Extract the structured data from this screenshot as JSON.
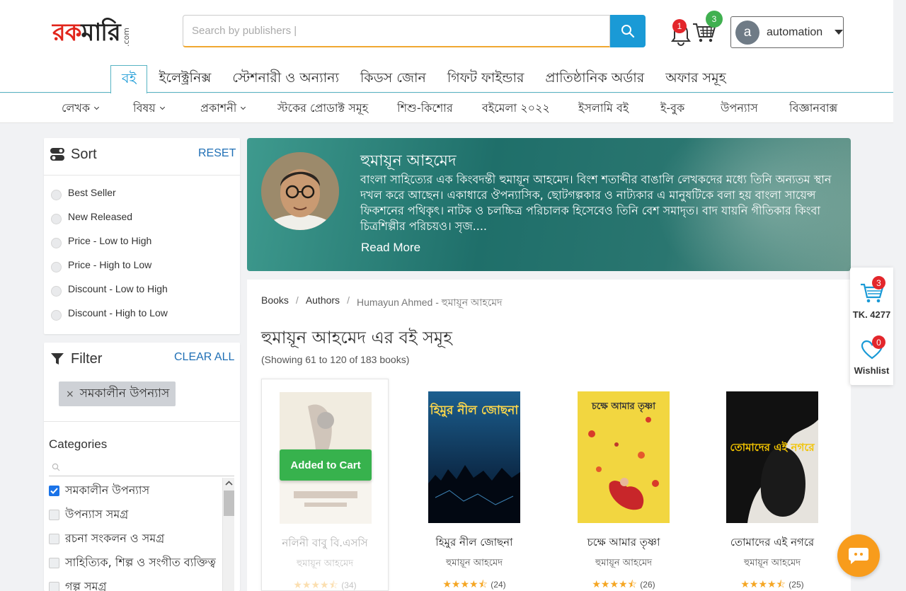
{
  "header": {
    "logo_text_red": "রক",
    "logo_text_dark": "মারি",
    "logo_com": ".com",
    "search_placeholder": "Search by publishers |",
    "notification_count": "1",
    "cart_count": "3",
    "account_initial": "a",
    "account_name": "automation"
  },
  "main_tabs": [
    "বই",
    "ইলেক্ট্রনিক্স",
    "স্টেশনারী ও অন্যান্য",
    "কিডস জোন",
    "গিফট ফাইন্ডার",
    "প্রাতিষ্ঠানিক অর্ডার",
    "অফার সমূহ"
  ],
  "sub_nav": [
    "লেখক",
    "বিষয়",
    "প্রকাশনী",
    "স্টকের প্রোডাক্ট সমূহ",
    "শিশু-কিশোর",
    "বইমেলা ২০২২",
    "ইসলামি বই",
    "ই-বুক",
    "উপন্যাস",
    "বিজ্ঞানবাক্স"
  ],
  "sort": {
    "title": "Sort",
    "reset": "RESET",
    "options": [
      "Best Seller",
      "New Released",
      "Price - Low to High",
      "Price - High to Low",
      "Discount - Low to High",
      "Discount - High to Low"
    ]
  },
  "filter": {
    "title": "Filter",
    "clear_all": "CLEAR ALL",
    "active_chip": "সমকালীন উপন্যাস",
    "chip_remove": "×",
    "categories_title": "Categories",
    "categories": [
      {
        "label": "সমকালীন উপন্যাস",
        "checked": true
      },
      {
        "label": "উপন্যাস সমগ্র",
        "checked": false
      },
      {
        "label": "রচনা সংকলন ও সমগ্র",
        "checked": false
      },
      {
        "label": "সাহিত্যিক, শিল্প ও সংগীত ব্যক্তিত্ব",
        "checked": false
      },
      {
        "label": "গল্প সমগ্র",
        "checked": false
      }
    ]
  },
  "author": {
    "name": "হুমায়ূন আহমেদ",
    "bio": "বাংলা সাহিত্যের এক কিংবদন্তী হুমায়ূন আহমেদ। বিংশ শতাব্দীর বাঙালি লেখকদের মধ্যে তিনি অন্যতম স্থান দখল করে আছেন। একাধারে ঔপন্যাসিক, ছোটগল্পকার ও নাট্যকার এ মানুষটিকে বলা হয় বাংলা সায়েন্স ফিকশনের পথিকৃৎ। নাটক ও চলচ্চিত্র পরিচালক হিসেবেও তিনি বেশ সমাদৃত। বাদ যায়নি গীতিকার কিংবা চিত্রশিল্পীর পরিচয়ও। সৃজ....",
    "read_more": "Read More"
  },
  "breadcrumb": [
    "Books",
    "Authors",
    "Humayun Ahmed - হুমায়ূন আহমেদ"
  ],
  "listing": {
    "title": "হুমায়ূন আহমেদ এর বই সমূহ",
    "count": "(Showing 61 to 120 of 183 books)",
    "added_label": "Added to Cart",
    "books": [
      {
        "title": "নলিনী বাবু বি.এসসি",
        "author": "হুমায়ূন আহমেদ",
        "stars": "★★★★⯪",
        "reviews": "(34)",
        "in_cart": true
      },
      {
        "title": "হিমুর নীল জোছনা",
        "author": "হুমায়ূন আহমেদ",
        "stars": "★★★★⯪",
        "reviews": "(24)",
        "cover_text": "হিমুর নীল জোছনা",
        "in_cart": false
      },
      {
        "title": "চক্ষে আমার তৃষ্ণা",
        "author": "হুমায়ূন আহমেদ",
        "stars": "★★★★⯪",
        "reviews": "(26)",
        "cover_text": "চক্ষে আমার তৃষ্ণা",
        "in_cart": false
      },
      {
        "title": "তোমাদের এই নগরে",
        "author": "হুমায়ূন আহমেদ",
        "stars": "★★★★⯪",
        "reviews": "(25)",
        "cover_text": "তোমাদের এই নগরে",
        "in_cart": false
      }
    ]
  },
  "floating": {
    "cart_count": "3",
    "cart_total": "TK. 4277",
    "wishlist_count": "0",
    "wishlist_label": "Wishlist"
  },
  "colors": {
    "accent": "#1a9ad6",
    "cta_green": "#37b24d",
    "badge_red": "#e3262b",
    "chat_orange": "#f89c1c"
  }
}
